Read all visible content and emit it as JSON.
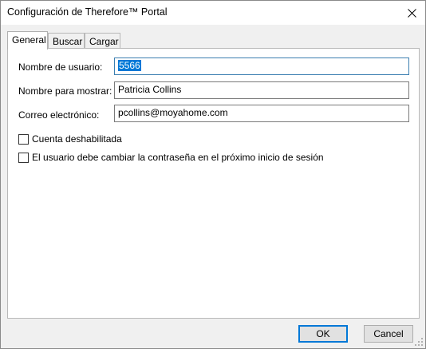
{
  "window": {
    "title": "Configuración de Therefore™ Portal"
  },
  "tabs": [
    {
      "label": "General",
      "active": true
    },
    {
      "label": "Buscar",
      "active": false
    },
    {
      "label": "Cargar",
      "active": false
    }
  ],
  "form": {
    "username": {
      "label": "Nombre de usuario:",
      "value": "5566"
    },
    "display_name": {
      "label": "Nombre para mostrar:",
      "value": "Patricia Collins"
    },
    "email": {
      "label": "Correo electrónico:",
      "value": "pcollins@moyahome.com"
    }
  },
  "checkboxes": [
    {
      "label": "Cuenta deshabilitada",
      "checked": false
    },
    {
      "label": "El usuario debe cambiar la contraseña en el próximo inicio de sesión",
      "checked": false
    }
  ],
  "buttons": {
    "ok": "OK",
    "cancel": "Cancel"
  },
  "colors": {
    "selection": "#0078d7",
    "default_button_border": "#0078d7"
  }
}
